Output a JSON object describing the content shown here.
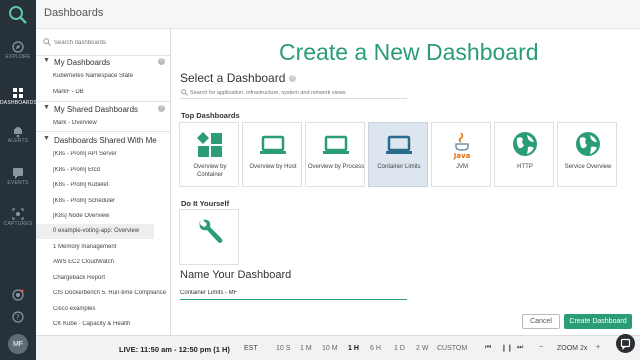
{
  "rail": {
    "items": [
      {
        "label": "EXPLORE",
        "icon": "compass-icon"
      },
      {
        "label": "DASHBOARDS",
        "icon": "dashboards-icon"
      },
      {
        "label": "ALERTS",
        "icon": "bell-icon"
      },
      {
        "label": "EVENTS",
        "icon": "chat-icon"
      },
      {
        "label": "CAPTURES",
        "icon": "capture-icon"
      }
    ],
    "avatar": "MF"
  },
  "topbar": {
    "title": "Dashboards"
  },
  "sidebar": {
    "search_placeholder": "Search dashboards",
    "sections": [
      {
        "label": "My Dashboards",
        "items": [
          "Kubernetes Namespace State",
          "MarkF - DB"
        ]
      },
      {
        "label": "My Shared Dashboards",
        "items": [
          "Mark - Overview"
        ]
      },
      {
        "label": "Dashboards Shared With Me",
        "items": [
          "[K8s - Prom] API Server",
          "[K8s - Prom] Etcd",
          "[K8s - Prom] Kubelet",
          "[K8s - Prom] Scheduler",
          "[K8s] Node Overview",
          "0 example-voting-app: Overview",
          "1 Memory management",
          "AWS EC2 CloudWatch",
          "Chargeback Report",
          "CIS Dockerbench 5. Run-time Compliance",
          "Cisco examples",
          "CK Kube - Capacity & Health"
        ]
      }
    ]
  },
  "main": {
    "title": "Create a New Dashboard",
    "select_title": "Select a Dashboard",
    "search_placeholder": "Search for application, infrastructure, system and network views",
    "top_label": "Top Dashboards",
    "cards": [
      {
        "label": "Overview by Container",
        "icon": "container-grid-icon"
      },
      {
        "label": "Overview by Host",
        "icon": "laptop-icon"
      },
      {
        "label": "Overview by Process",
        "icon": "laptop-icon"
      },
      {
        "label": "Container Limits",
        "icon": "laptop-icon"
      },
      {
        "label": "JVM",
        "icon": "java-icon",
        "icon_text": "Java"
      },
      {
        "label": "HTTP",
        "icon": "globe-icon"
      },
      {
        "label": "Service Overview",
        "icon": "globe-icon"
      }
    ],
    "diy_label": "Do It Yourself",
    "diy_card": {
      "icon": "wrench-icon"
    },
    "name_title": "Name Your Dashboard",
    "name_value": "Container Limits - MF",
    "cancel_label": "Cancel",
    "create_label": "Create Dashboard"
  },
  "bottombar": {
    "live": "LIVE: 11:50 am - 12:50 pm (1 H)",
    "tz": "EST",
    "ranges": [
      "10 S",
      "1 M",
      "10 M",
      "1 H",
      "6 H",
      "1 D",
      "2 W",
      "CUSTOM"
    ],
    "selected_range": "1 H",
    "zoom": "ZOOM 2x"
  },
  "colors": {
    "accent": "#2a9d75",
    "rail": "#27313a",
    "selected_card": "#dde6ef"
  }
}
